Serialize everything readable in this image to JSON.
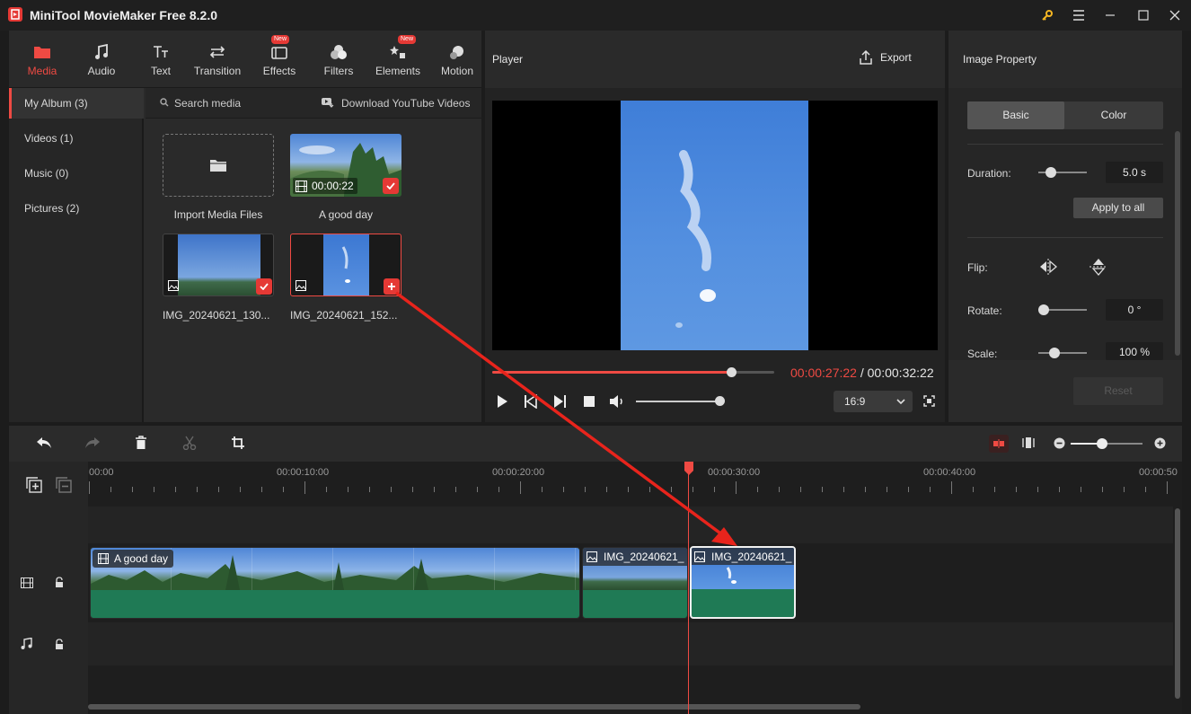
{
  "app": {
    "title": "MiniTool MovieMaker Free 8.2.0"
  },
  "toolbar": {
    "tabs": [
      {
        "label": "Media",
        "icon": "folder-icon",
        "active": true,
        "badge": ""
      },
      {
        "label": "Audio",
        "icon": "music-note-icon",
        "active": false,
        "badge": ""
      },
      {
        "label": "Text",
        "icon": "text-icon",
        "active": false,
        "badge": ""
      },
      {
        "label": "Transition",
        "icon": "transition-arrows-icon",
        "active": false,
        "badge": ""
      },
      {
        "label": "Effects",
        "icon": "effects-icon",
        "active": false,
        "badge": "New"
      },
      {
        "label": "Filters",
        "icon": "filters-icon",
        "active": false,
        "badge": ""
      },
      {
        "label": "Elements",
        "icon": "elements-icon",
        "active": false,
        "badge": "New"
      },
      {
        "label": "Motion",
        "icon": "motion-icon",
        "active": false,
        "badge": ""
      }
    ]
  },
  "album": {
    "items": [
      {
        "label": "My Album (3)",
        "active": true
      },
      {
        "label": "Videos (1)",
        "active": false
      },
      {
        "label": "Music (0)",
        "active": false
      },
      {
        "label": "Pictures (2)",
        "active": false
      }
    ]
  },
  "media": {
    "search_label": "Search media",
    "download_label": "Download YouTube Videos",
    "import_label": "Import Media Files",
    "items": [
      {
        "label": "A good day",
        "duration": "00:00:22",
        "type": "video"
      },
      {
        "label": "IMG_20240621_130...",
        "type": "image"
      },
      {
        "label": "IMG_20240621_152...",
        "type": "image"
      }
    ]
  },
  "player": {
    "title": "Player",
    "export_label": "Export",
    "current_time": "00:00:27:22",
    "separator": " / ",
    "total_time": "00:00:32:22",
    "progress": 0.84,
    "volume": 0.85,
    "aspect": "16:9"
  },
  "property": {
    "title": "Image Property",
    "tab_basic": "Basic",
    "tab_color": "Color",
    "duration_label": "Duration:",
    "duration_value": "5.0 s",
    "apply_all": "Apply to all",
    "flip_label": "Flip:",
    "rotate_label": "Rotate:",
    "rotate_value": "0 °",
    "scale_label": "Scale:",
    "scale_value": "100 %",
    "reset_label": "Reset"
  },
  "timeline": {
    "ruler": [
      "00:00",
      "00:00:10:00",
      "00:00:20:00",
      "00:00:30:00",
      "00:00:40:00",
      "00:00:50"
    ],
    "clips": [
      {
        "label": "A good day",
        "type": "video"
      },
      {
        "label": "IMG_20240621_",
        "type": "image"
      },
      {
        "label": "IMG_20240621_",
        "type": "image",
        "selected": true
      }
    ],
    "playhead_seconds": 27.7
  },
  "colors": {
    "accent": "#ef4a43",
    "sky": "#4f86d6",
    "grass": "#1f7a55"
  }
}
